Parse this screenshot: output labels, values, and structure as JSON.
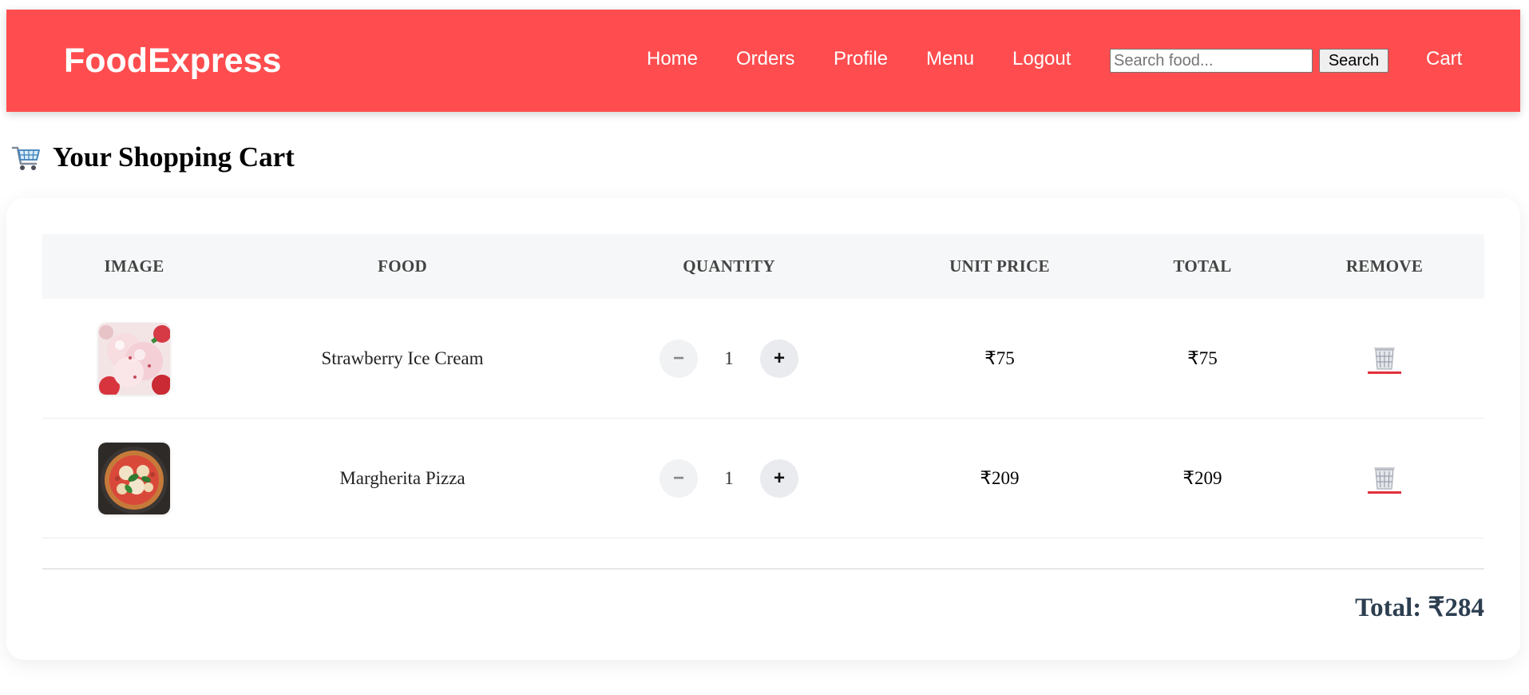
{
  "brand": {
    "name": "FoodExpress",
    "color": "#ff4d4f"
  },
  "nav": {
    "links": [
      "Home",
      "Orders",
      "Profile",
      "Menu",
      "Logout"
    ],
    "cart_label": "Cart"
  },
  "search": {
    "placeholder": "Search food...",
    "value": "",
    "button_label": "Search"
  },
  "page": {
    "title": "Your Shopping Cart",
    "title_icon": "shopping-cart-icon"
  },
  "table": {
    "headers": [
      "IMAGE",
      "FOOD",
      "QUANTITY",
      "UNIT PRICE",
      "TOTAL",
      "REMOVE"
    ],
    "rows": [
      {
        "image_icon": "strawberry-ice-cream-image",
        "food": "Strawberry Ice Cream",
        "quantity": "1",
        "unit_price": "₹75",
        "total": "₹75",
        "remove_icon": "trash-icon"
      },
      {
        "image_icon": "margherita-pizza-image",
        "food": "Margherita Pizza",
        "quantity": "1",
        "unit_price": "₹209",
        "total": "₹209",
        "remove_icon": "trash-icon"
      }
    ],
    "minus_label": "−",
    "plus_label": "+"
  },
  "summary": {
    "total_text": "Total: ₹284"
  },
  "colors": {
    "header_bg": "#ff4d4f",
    "total_text": "#2c3e50",
    "remove_underline": "#e0303a"
  }
}
